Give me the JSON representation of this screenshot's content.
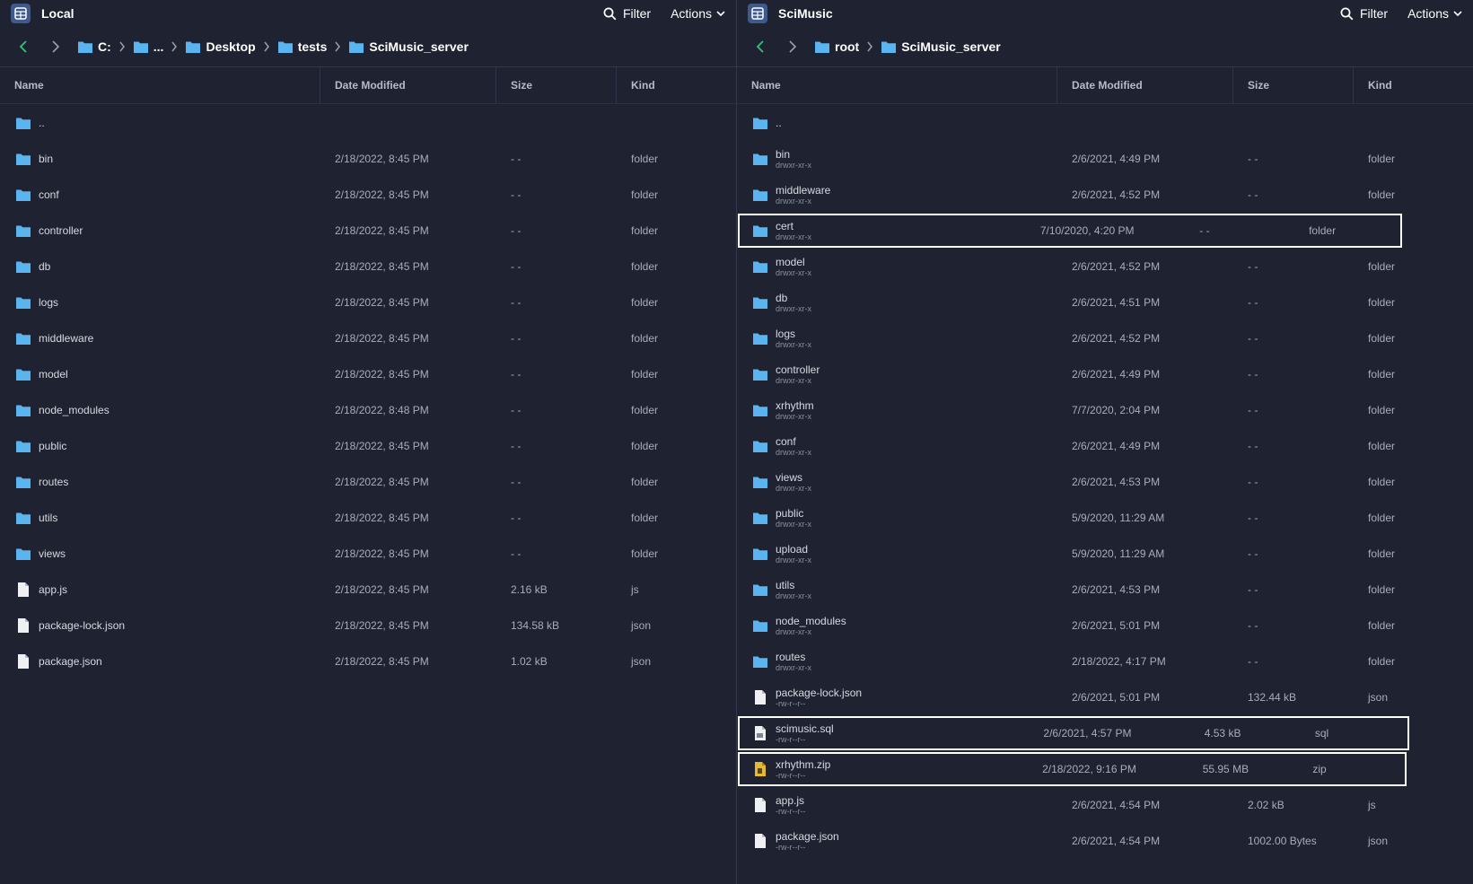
{
  "colors": {
    "folder": "#5ab4f0",
    "accent_back": "#34c37a",
    "file": "#eef0f4",
    "zip": "#e8b830"
  },
  "left": {
    "title": "Local",
    "filter_label": "Filter",
    "actions_label": "Actions",
    "breadcrumb": [
      "C:",
      "...",
      "Desktop",
      "tests",
      "SciMusic_server"
    ],
    "columns": {
      "name": "Name",
      "date": "Date Modified",
      "size": "Size",
      "kind": "Kind"
    },
    "rows": [
      {
        "name": "..",
        "date": "",
        "size": "",
        "kind": "",
        "icon": "folder-icon"
      },
      {
        "name": "bin",
        "date": "2/18/2022, 8:45 PM",
        "size": "- -",
        "kind": "folder",
        "icon": "folder-icon"
      },
      {
        "name": "conf",
        "date": "2/18/2022, 8:45 PM",
        "size": "- -",
        "kind": "folder",
        "icon": "folder-icon"
      },
      {
        "name": "controller",
        "date": "2/18/2022, 8:45 PM",
        "size": "- -",
        "kind": "folder",
        "icon": "folder-icon"
      },
      {
        "name": "db",
        "date": "2/18/2022, 8:45 PM",
        "size": "- -",
        "kind": "folder",
        "icon": "folder-icon"
      },
      {
        "name": "logs",
        "date": "2/18/2022, 8:45 PM",
        "size": "- -",
        "kind": "folder",
        "icon": "folder-icon"
      },
      {
        "name": "middleware",
        "date": "2/18/2022, 8:45 PM",
        "size": "- -",
        "kind": "folder",
        "icon": "folder-icon"
      },
      {
        "name": "model",
        "date": "2/18/2022, 8:45 PM",
        "size": "- -",
        "kind": "folder",
        "icon": "folder-icon"
      },
      {
        "name": "node_modules",
        "date": "2/18/2022, 8:48 PM",
        "size": "- -",
        "kind": "folder",
        "icon": "folder-icon"
      },
      {
        "name": "public",
        "date": "2/18/2022, 8:45 PM",
        "size": "- -",
        "kind": "folder",
        "icon": "folder-icon"
      },
      {
        "name": "routes",
        "date": "2/18/2022, 8:45 PM",
        "size": "- -",
        "kind": "folder",
        "icon": "folder-icon"
      },
      {
        "name": "utils",
        "date": "2/18/2022, 8:45 PM",
        "size": "- -",
        "kind": "folder",
        "icon": "folder-icon"
      },
      {
        "name": "views",
        "date": "2/18/2022, 8:45 PM",
        "size": "- -",
        "kind": "folder",
        "icon": "folder-icon"
      },
      {
        "name": "app.js",
        "date": "2/18/2022, 8:45 PM",
        "size": "2.16 kB",
        "kind": "js",
        "icon": "file-icon"
      },
      {
        "name": "package-lock.json",
        "date": "2/18/2022, 8:45 PM",
        "size": "134.58 kB",
        "kind": "json",
        "icon": "file-icon"
      },
      {
        "name": "package.json",
        "date": "2/18/2022, 8:45 PM",
        "size": "1.02 kB",
        "kind": "json",
        "icon": "file-icon"
      }
    ]
  },
  "right": {
    "title": "SciMusic",
    "filter_label": "Filter",
    "actions_label": "Actions",
    "breadcrumb": [
      "root",
      "SciMusic_server"
    ],
    "columns": {
      "name": "Name",
      "date": "Date Modified",
      "size": "Size",
      "kind": "Kind"
    },
    "rows": [
      {
        "name": "..",
        "perm": "",
        "date": "",
        "size": "",
        "kind": "",
        "icon": "folder-icon"
      },
      {
        "name": "bin",
        "perm": "drwxr-xr-x",
        "date": "2/6/2021, 4:49 PM",
        "size": "- -",
        "kind": "folder",
        "icon": "folder-icon"
      },
      {
        "name": "middleware",
        "perm": "drwxr-xr-x",
        "date": "2/6/2021, 4:52 PM",
        "size": "- -",
        "kind": "folder",
        "icon": "folder-icon"
      },
      {
        "name": "cert",
        "perm": "drwxr-xr-x",
        "date": "7/10/2020, 4:20 PM",
        "size": "- -",
        "kind": "folder",
        "icon": "folder-icon",
        "highlight": "hl1"
      },
      {
        "name": "model",
        "perm": "drwxr-xr-x",
        "date": "2/6/2021, 4:52 PM",
        "size": "- -",
        "kind": "folder",
        "icon": "folder-icon"
      },
      {
        "name": "db",
        "perm": "drwxr-xr-x",
        "date": "2/6/2021, 4:51 PM",
        "size": "- -",
        "kind": "folder",
        "icon": "folder-icon"
      },
      {
        "name": "logs",
        "perm": "drwxr-xr-x",
        "date": "2/6/2021, 4:52 PM",
        "size": "- -",
        "kind": "folder",
        "icon": "folder-icon"
      },
      {
        "name": "controller",
        "perm": "drwxr-xr-x",
        "date": "2/6/2021, 4:49 PM",
        "size": "- -",
        "kind": "folder",
        "icon": "folder-icon"
      },
      {
        "name": "xrhythm",
        "perm": "drwxr-xr-x",
        "date": "7/7/2020, 2:04 PM",
        "size": "- -",
        "kind": "folder",
        "icon": "folder-icon"
      },
      {
        "name": "conf",
        "perm": "drwxr-xr-x",
        "date": "2/6/2021, 4:49 PM",
        "size": "- -",
        "kind": "folder",
        "icon": "folder-icon"
      },
      {
        "name": "views",
        "perm": "drwxr-xr-x",
        "date": "2/6/2021, 4:53 PM",
        "size": "- -",
        "kind": "folder",
        "icon": "folder-icon"
      },
      {
        "name": "public",
        "perm": "drwxr-xr-x",
        "date": "5/9/2020, 11:29 AM",
        "size": "- -",
        "kind": "folder",
        "icon": "folder-icon"
      },
      {
        "name": "upload",
        "perm": "drwxr-xr-x",
        "date": "5/9/2020, 11:29 AM",
        "size": "- -",
        "kind": "folder",
        "icon": "folder-icon"
      },
      {
        "name": "utils",
        "perm": "drwxr-xr-x",
        "date": "2/6/2021, 4:53 PM",
        "size": "- -",
        "kind": "folder",
        "icon": "folder-icon"
      },
      {
        "name": "node_modules",
        "perm": "drwxr-xr-x",
        "date": "2/6/2021, 5:01 PM",
        "size": "- -",
        "kind": "folder",
        "icon": "folder-icon"
      },
      {
        "name": "routes",
        "perm": "drwxr-xr-x",
        "date": "2/18/2022, 4:17 PM",
        "size": "- -",
        "kind": "folder",
        "icon": "folder-icon"
      },
      {
        "name": "package-lock.json",
        "perm": "-rw-r--r--",
        "date": "2/6/2021, 5:01 PM",
        "size": "132.44 kB",
        "kind": "json",
        "icon": "file-icon"
      },
      {
        "name": "scimusic.sql",
        "perm": "-rw-r--r--",
        "date": "2/6/2021, 4:57 PM",
        "size": "4.53 kB",
        "kind": "sql",
        "icon": "sql-file-icon",
        "highlight": "hl2"
      },
      {
        "name": "xrhythm.zip",
        "perm": "-rw-r--r--",
        "date": "2/18/2022, 9:16 PM",
        "size": "55.95 MB",
        "kind": "zip",
        "icon": "zip-file-icon",
        "highlight": "hl3"
      },
      {
        "name": "app.js",
        "perm": "-rw-r--r--",
        "date": "2/6/2021, 4:54 PM",
        "size": "2.02 kB",
        "kind": "js",
        "icon": "file-icon"
      },
      {
        "name": "package.json",
        "perm": "-rw-r--r--",
        "date": "2/6/2021, 4:54 PM",
        "size": "1002.00 Bytes",
        "kind": "json",
        "icon": "file-icon"
      }
    ]
  }
}
